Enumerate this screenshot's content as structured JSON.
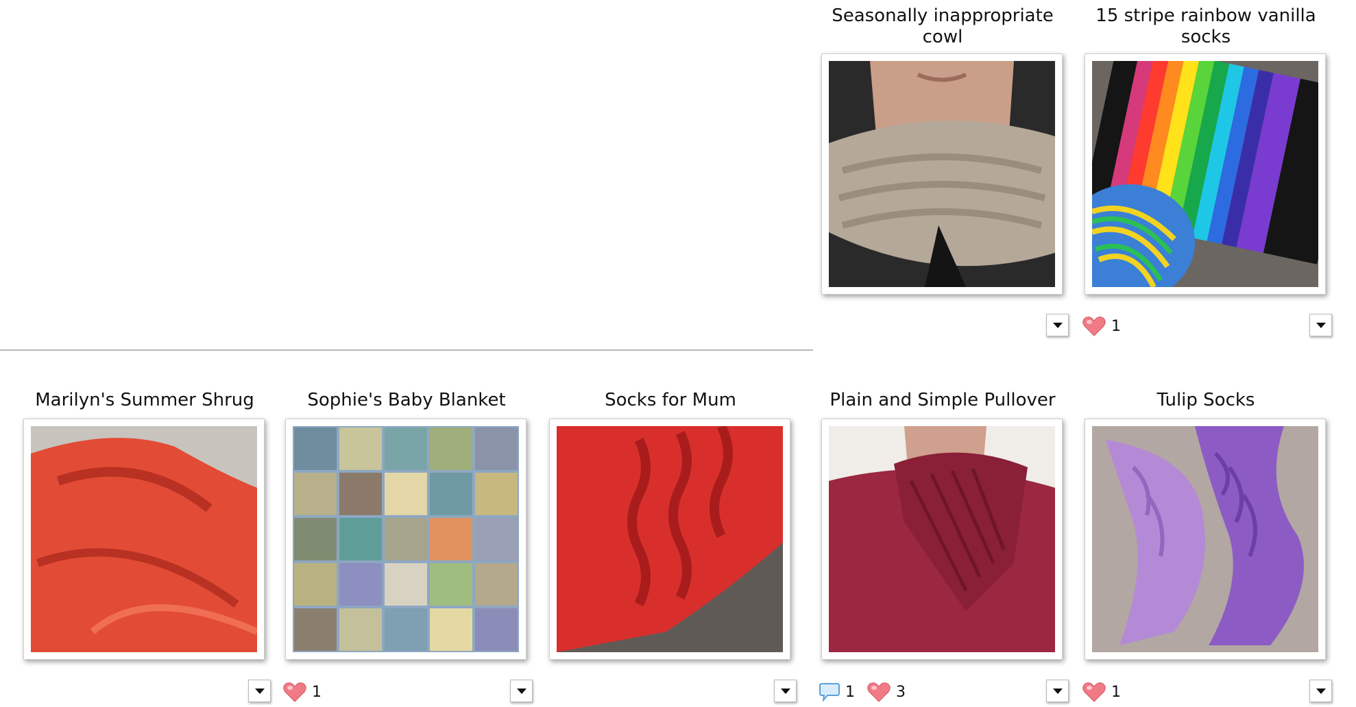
{
  "projects": [
    {
      "id": "cowl",
      "title": "Seasonally inappropriate cowl",
      "comments": null,
      "hearts": null
    },
    {
      "id": "rainbow",
      "title": "15 stripe rainbow vanilla socks",
      "comments": null,
      "hearts": "1"
    },
    {
      "id": "shrug",
      "title": "Marilyn's Summer Shrug",
      "comments": null,
      "hearts": null
    },
    {
      "id": "blanket",
      "title": "Sophie's Baby Blanket",
      "comments": null,
      "hearts": "1"
    },
    {
      "id": "mum",
      "title": "Socks for Mum",
      "comments": null,
      "hearts": null
    },
    {
      "id": "pullover",
      "title": "Plain and Simple Pullover",
      "comments": "1",
      "hearts": "3"
    },
    {
      "id": "tulip",
      "title": "Tulip Socks",
      "comments": null,
      "hearts": "1"
    }
  ],
  "icons": {
    "heart": "heart-icon",
    "comment": "comment-bubble-icon",
    "menu": "dropdown-arrow-icon"
  },
  "colors": {
    "heart": "#f07a86",
    "bubble": "#5aa0d8",
    "divider": "#b7b7b7"
  }
}
